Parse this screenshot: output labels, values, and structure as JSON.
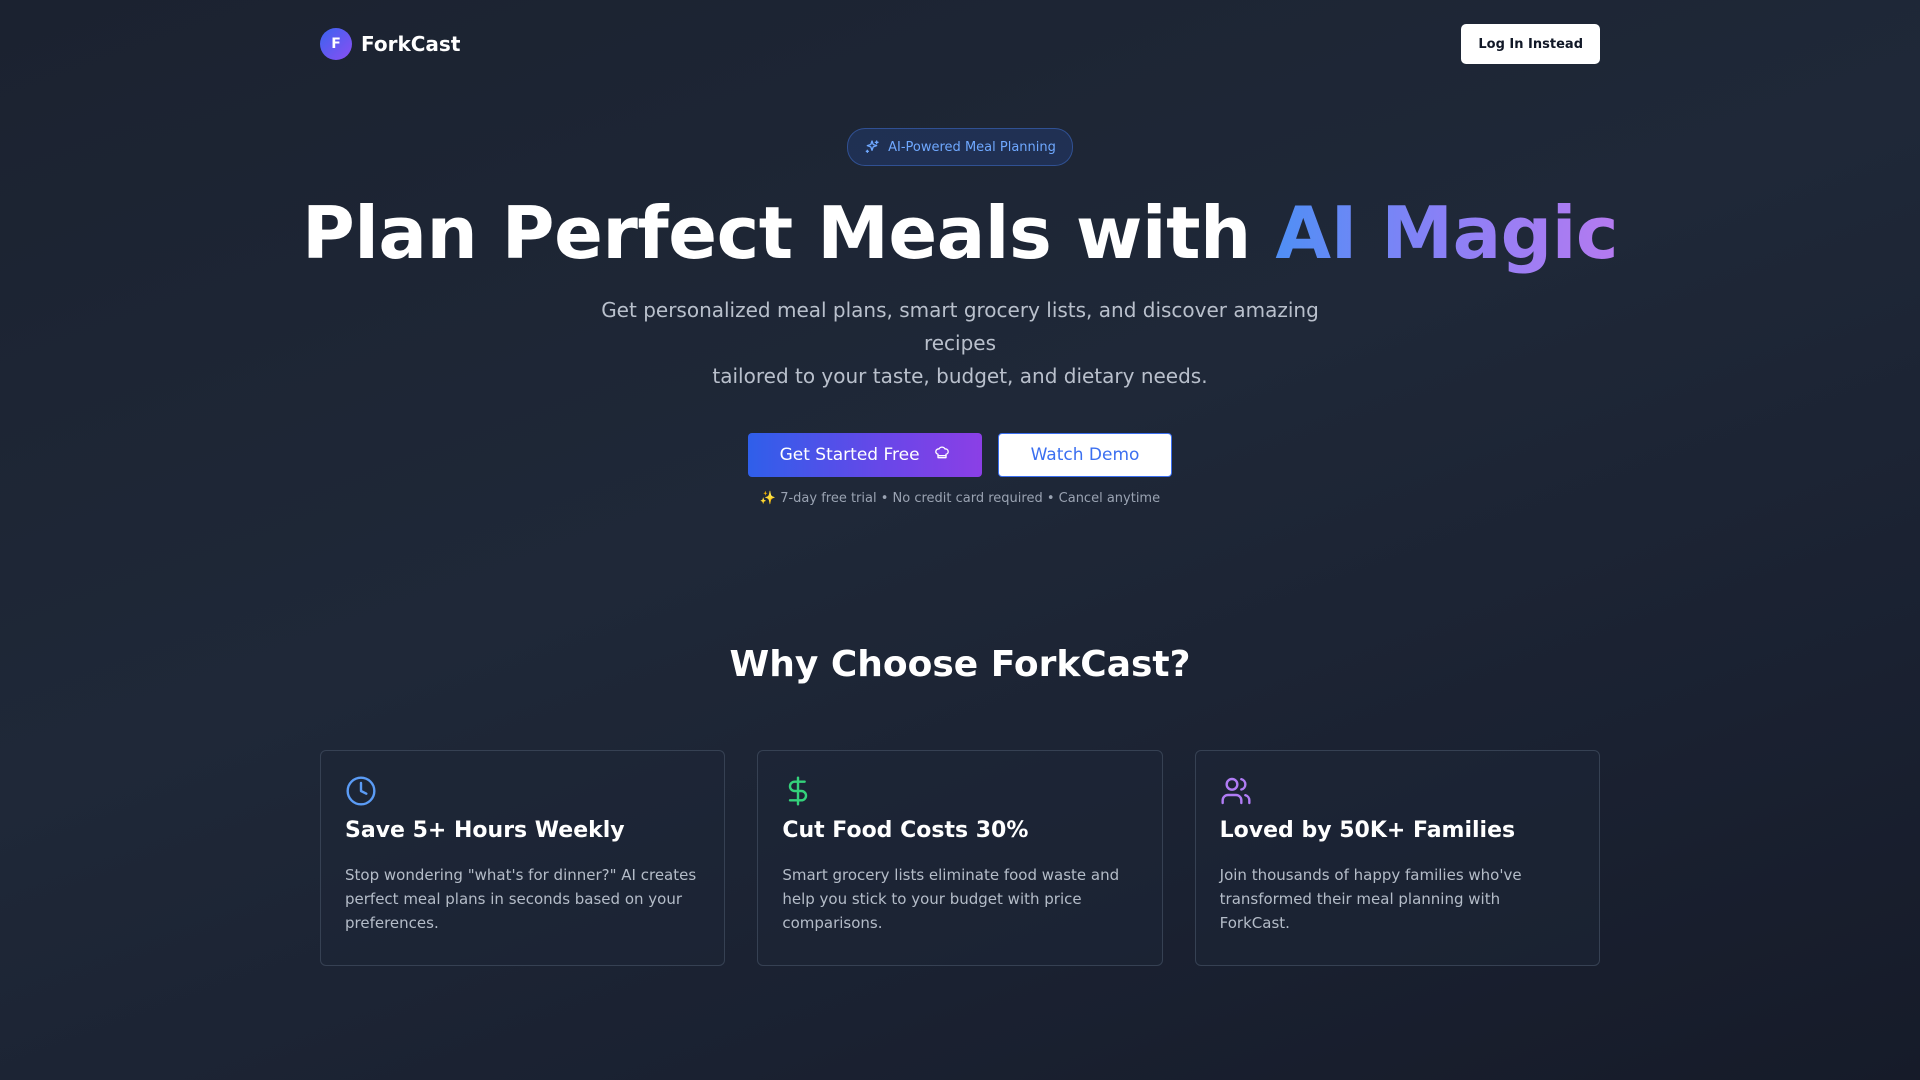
{
  "header": {
    "brand_initial": "F",
    "brand_name": "ForkCast",
    "login_label": "Log In Instead"
  },
  "hero": {
    "badge_label": "AI-Powered Meal Planning",
    "badge_icon": "sparkles-icon",
    "title_main": "Plan Perfect Meals with ",
    "title_highlight": "AI Magic",
    "subtitle_line1": "Get personalized meal plans, smart grocery lists, and discover amazing recipes",
    "subtitle_line2": "tailored to your taste, budget, and dietary needs.",
    "cta_primary_label": "Get Started Free",
    "cta_primary_icon": "chef-hat-icon",
    "cta_secondary_label": "Watch Demo",
    "note": "✨ 7-day free trial • No credit card required • Cancel anytime"
  },
  "features": {
    "title": "Why Choose ForkCast?",
    "cards": [
      {
        "icon": "clock-icon",
        "icon_color": "#5b9cf6",
        "title": "Save 5+ Hours Weekly",
        "text": "Stop wondering \"what's for dinner?\" AI creates perfect meal plans in seconds based on your preferences."
      },
      {
        "icon": "dollar-sign-icon",
        "icon_color": "#34d27b",
        "title": "Cut Food Costs 30%",
        "text": "Smart grocery lists eliminate food waste and help you stick to your budget with price comparisons."
      },
      {
        "icon": "users-icon",
        "icon_color": "#b07cf5",
        "title": "Loved by 50K+ Families",
        "text": "Join thousands of happy families who've transformed their meal planning with ForkCast."
      }
    ]
  },
  "colors": {
    "accent_blue": "#3b6ff0",
    "accent_purple": "#8b3fe6",
    "background": "#1f2838"
  }
}
